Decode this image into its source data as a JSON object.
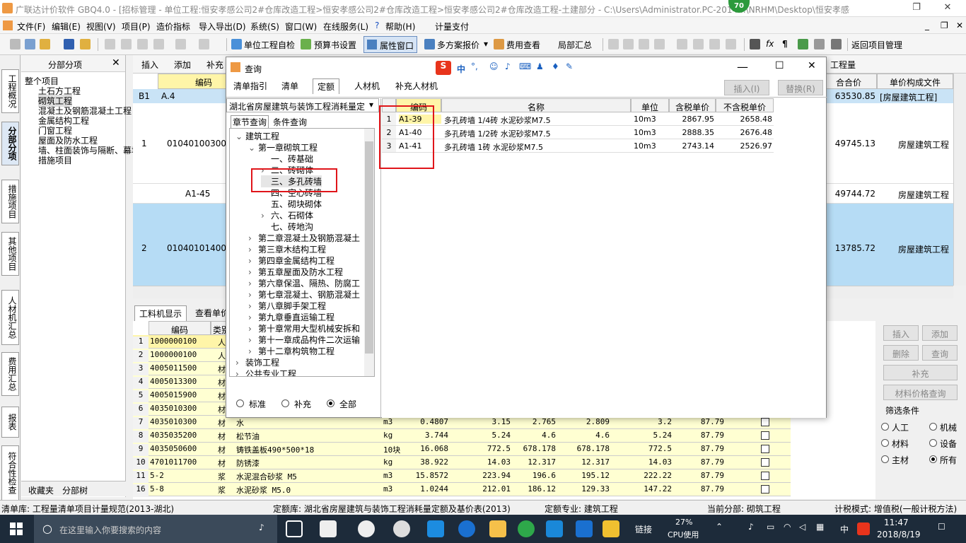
{
  "window": {
    "title": "广联达计价软件 GBQ4.0 - [招标管理 - 单位工程:恒安孝感公司2#仓库改造工程>恒安孝感公司2#仓库改造工程>恒安孝感公司2#仓库改造工程-土建部分 - C:\\Users\\Administrator.PC-2014...\\NRHM\\Desktop\\恒安孝感公...",
    "badge": "70",
    "restore": "❐",
    "close": "✕"
  },
  "menubar": {
    "items": [
      "文件(F)",
      "编辑(E)",
      "视图(V)",
      "项目(P)",
      "造价指标",
      "导入导出(D)",
      "系统(S)",
      "窗口(W)",
      "在线服务(L)",
      "帮助(H)",
      "计量支付"
    ],
    "right": [
      "_",
      "❐",
      "✕"
    ]
  },
  "toolbar": {
    "items": [
      "单位工程自检",
      "预算书设置",
      "属性窗口",
      "多方案报价",
      "费用查看",
      "局部汇总",
      "返回项目管理"
    ]
  },
  "lefttabs": [
    "工程概况",
    "分部分项",
    "措施项目",
    "其他项目",
    "人材机汇总",
    "费用汇总",
    "报表",
    "符合性检查"
  ],
  "treepanel": {
    "title": "分部分项",
    "close": "✕",
    "items": [
      "整个项目",
      "土石方工程",
      "砌筑工程",
      "混凝土及钢筋混凝土工程",
      "金属结构工程",
      "门窗工程",
      "屋面及防水工程",
      "墙、柱面装饰与隔断、幕墙",
      "措施项目"
    ],
    "bottom_tabs": [
      "收藏夹",
      "分部树"
    ]
  },
  "mainhdr": {
    "items": [
      "插入",
      "添加",
      "补充"
    ],
    "right_label": "工程量"
  },
  "upper": {
    "col_code": "编码",
    "col_total": "合合价",
    "col_file": "单价构成文件",
    "rows": [
      {
        "no": "B1",
        "code": "A.4",
        "total": "63530.85",
        "file": "[房屋建筑工程]"
      },
      {
        "no": "1",
        "code": "01040100300",
        "total": "49745.13",
        "file": "房屋建筑工程"
      },
      {
        "no": "",
        "code": "A1-45",
        "total": "49744.72",
        "file": "房屋建筑工程"
      },
      {
        "no": "2",
        "code": "01040101400",
        "total": "13785.72",
        "file": "房屋建筑工程"
      }
    ]
  },
  "lowertabs": [
    "工料机显示",
    "查看单价"
  ],
  "lower": {
    "col_code": "编码",
    "col_type": "类别",
    "rows": [
      {
        "no": "1",
        "code": "1000000100",
        "type": "人",
        "name": "",
        "unit": "",
        "qty": "",
        "p1": "",
        "p2": "",
        "p3": "",
        "p4": "",
        "p5": "",
        "rate": ""
      },
      {
        "no": "2",
        "code": "1000000100",
        "type": "人",
        "name": "",
        "unit": "",
        "qty": "",
        "p1": "",
        "p2": "",
        "p3": "",
        "p4": "",
        "p5": "",
        "rate": ""
      },
      {
        "no": "3",
        "code": "4005011500",
        "type": "材",
        "name": "",
        "unit": "",
        "qty": "",
        "p1": "",
        "p2": "",
        "p3": "",
        "p4": "",
        "p5": "",
        "rate": ""
      },
      {
        "no": "4",
        "code": "4005013300",
        "type": "材",
        "name": "",
        "unit": "",
        "qty": "",
        "p1": "",
        "p2": "",
        "p3": "",
        "p4": "",
        "p5": "",
        "rate": ""
      },
      {
        "no": "5",
        "code": "4005015900",
        "type": "材",
        "name": "",
        "unit": "",
        "qty": "",
        "p1": "",
        "p2": "",
        "p3": "",
        "p4": "",
        "p5": "",
        "rate": ""
      },
      {
        "no": "6",
        "code": "4035010300",
        "type": "材",
        "name": "",
        "unit": "",
        "qty": "",
        "p1": "",
        "p2": "",
        "p3": "",
        "p4": "",
        "p5": "",
        "rate": ""
      },
      {
        "no": "7",
        "code": "4035010300",
        "type": "材",
        "name": "水",
        "unit": "m3",
        "qty": "0.4807",
        "p1": "3.15",
        "p2": "2.765",
        "p3": "2.809",
        "p4": "3.2",
        "p5": "87.79",
        "rate": ""
      },
      {
        "no": "8",
        "code": "4035035200",
        "type": "材",
        "name": "松节油",
        "unit": "kg",
        "qty": "3.744",
        "p1": "5.24",
        "p2": "4.6",
        "p3": "4.6",
        "p4": "5.24",
        "p5": "87.79",
        "rate": ""
      },
      {
        "no": "9",
        "code": "4035050600",
        "type": "材",
        "name": "铸铁盖板490*500*18",
        "unit": "10块",
        "qty": "16.068",
        "p1": "772.5",
        "p2": "678.178",
        "p3": "678.178",
        "p4": "772.5",
        "p5": "87.79",
        "rate": ""
      },
      {
        "no": "10",
        "code": "4701011700",
        "type": "材",
        "name": "防锈漆",
        "unit": "kg",
        "qty": "38.922",
        "p1": "14.03",
        "p2": "12.317",
        "p3": "12.317",
        "p4": "14.03",
        "p5": "87.79",
        "rate": ""
      },
      {
        "no": "11",
        "code": "5-2",
        "type": "浆",
        "name": "水泥混合砂浆 M5",
        "unit": "m3",
        "qty": "15.8572",
        "p1": "223.94",
        "p2": "196.6",
        "p3": "195.12",
        "p4": "222.22",
        "p5": "87.79",
        "rate": "+"
      },
      {
        "no": "16",
        "code": "5-8",
        "type": "浆",
        "name": "水泥砂浆 M5.0",
        "unit": "m3",
        "qty": "1.0244",
        "p1": "212.01",
        "p2": "186.12",
        "p3": "129.33",
        "p4": "147.22",
        "p5": "87.79",
        "rate": "+"
      }
    ]
  },
  "rightpanel": {
    "buttons": [
      "插入",
      "添加",
      "删除",
      "查询",
      "补充",
      "材料价格查询"
    ],
    "filter_title": "筛选条件",
    "filters": [
      "人工",
      "机械",
      "材料",
      "设备",
      "主材",
      "所有"
    ]
  },
  "dialog": {
    "title": "查询",
    "ime": "中",
    "tabs": [
      "清单指引",
      "清单",
      "定额",
      "人材机",
      "补充人材机"
    ],
    "insert": "插入(I)",
    "replace": "替换(R)",
    "library": "湖北省房屋建筑与装饰工程消耗量定",
    "subtabs": [
      "章节查询",
      "条件查询"
    ],
    "tree": [
      "建筑工程",
      "第一章砌筑工程",
      "一、砖基础",
      "二、砖砌体",
      "三、多孔砖墙",
      "四、空心砖墙",
      "五、砌块砌体",
      "六、石砌体",
      "七、砖地沟",
      "第二章混凝土及钢筋混凝土",
      "第三章木结构工程",
      "第四章金属结构工程",
      "第五章屋面及防水工程",
      "第六章保温、隔热、防腐工",
      "第七章混凝土、钢筋混凝土",
      "第八章脚手架工程",
      "第九章垂直运输工程",
      "第十章常用大型机械安拆和",
      "第十一章成品构件二次运输",
      "第十二章构筑物工程",
      "装饰工程",
      "公共专业工程"
    ],
    "radios": [
      "标准",
      "补充",
      "全部"
    ],
    "cols": [
      "编码",
      "名称",
      "单位",
      "含税单价",
      "不含税单价"
    ],
    "rows": [
      {
        "no": "1",
        "code": "A1-39",
        "name": "多孔砖墙 1/4砖 水泥砂浆M7.5",
        "unit": "10m3",
        "p1": "2867.95",
        "p2": "2658.48"
      },
      {
        "no": "2",
        "code": "A1-40",
        "name": "多孔砖墙 1/2砖 水泥砂浆M7.5",
        "unit": "10m3",
        "p1": "2888.35",
        "p2": "2676.48"
      },
      {
        "no": "3",
        "code": "A1-41",
        "name": "多孔砖墙 1砖 水泥砂浆M7.5",
        "unit": "10m3",
        "p1": "2743.14",
        "p2": "2526.97"
      }
    ]
  },
  "statusbar": {
    "a": "清单库: 工程量清单项目计量规范(2013-湖北)",
    "b": "定额库: 湖北省房屋建筑与装饰工程消耗量定额及基价表(2013)",
    "c": "定额专业: 建筑工程",
    "d": "当前分部: 砌筑工程",
    "e": "计税模式: 增值税(一般计税方法)"
  },
  "taskbar": {
    "search": "在这里输入你要搜索的内容",
    "link": "链接",
    "cpu_pct": "27%",
    "cpu": "CPU使用",
    "time": "11:47",
    "date": "2018/8/19",
    "lang": "中"
  }
}
